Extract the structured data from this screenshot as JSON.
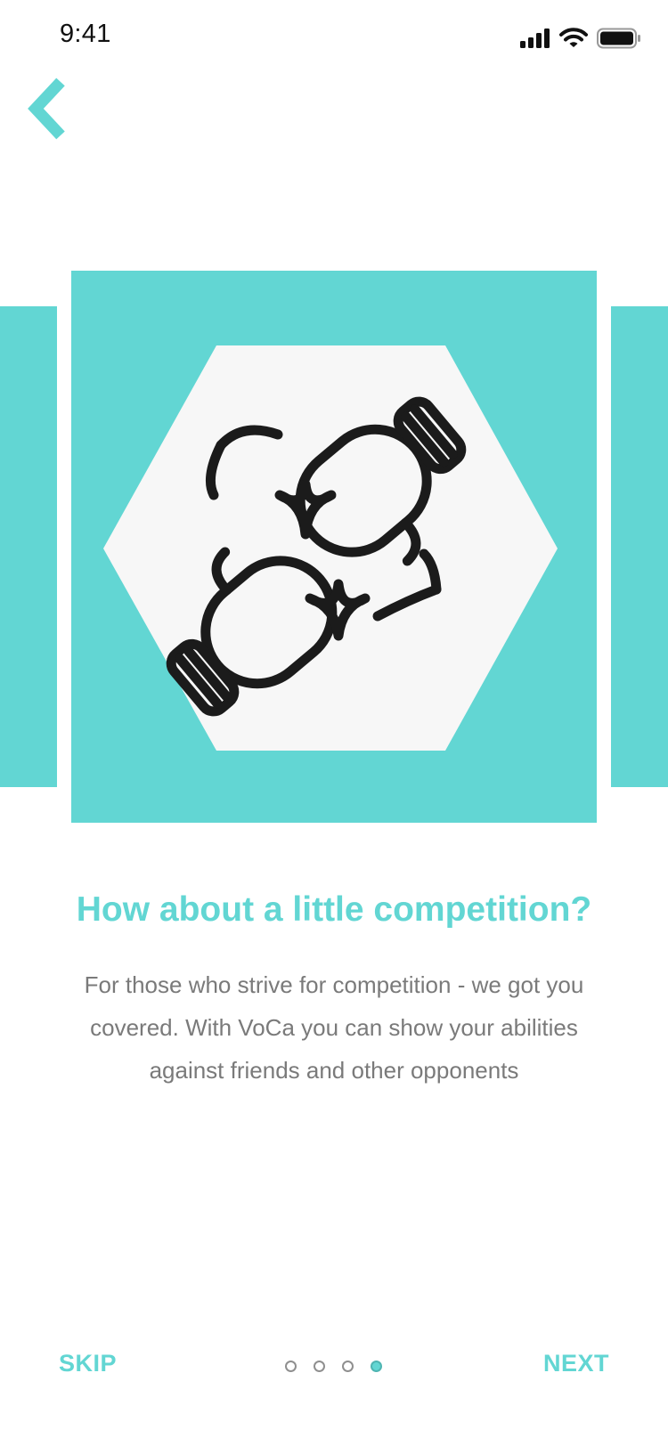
{
  "status_bar": {
    "time": "9:41"
  },
  "navigation": {
    "back_icon": "chevron-left-icon"
  },
  "onboarding": {
    "illustration_icon": "boxing-gloves-icon",
    "title": "How about a little competition?",
    "description": "For those who strive for competition - we got you covered. With VoCa you can show your abilities against friends and other opponents"
  },
  "footer": {
    "skip_label": "SKIP",
    "next_label": "NEXT",
    "page_count": 4,
    "current_page": 4
  },
  "colors": {
    "accent": "#62d6d3",
    "hexagon": "#f7f7f7",
    "body_text": "#7a7a7a",
    "icon_stroke": "#1b1b1b"
  }
}
